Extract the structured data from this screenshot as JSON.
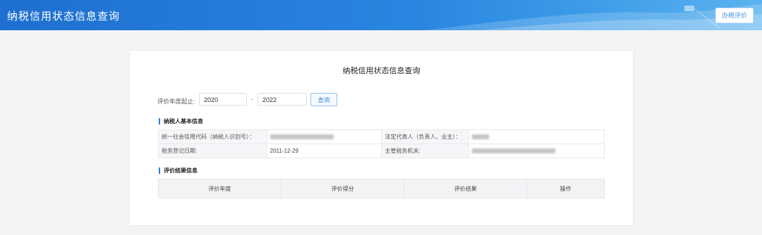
{
  "header": {
    "title": "纳税信用状态信息查询",
    "eval_button": "办税评价"
  },
  "card": {
    "title": "纳税信用状态信息查询",
    "filter": {
      "label": "评价年度起止:",
      "start_year": "2020",
      "end_year": "2022",
      "separator": "-",
      "query_button": "查询"
    },
    "basic_info": {
      "section_title": "纳税人基本信息",
      "credit_code_label": "统一社会信用代码（纳税人识别号）：",
      "legal_rep_label": "法定代表人（负责人、业主）：",
      "reg_date_label": "税务登记日期:",
      "reg_date_value": "2011-12-29",
      "tax_authority_label": "主管税务机关:"
    },
    "results": {
      "section_title": "评价结果信息",
      "columns": [
        "评价年度",
        "评价得分",
        "评价结果",
        "操作"
      ]
    }
  },
  "colors": {
    "header_blue": "#2a86e0",
    "accent": "#2c7fd6"
  }
}
